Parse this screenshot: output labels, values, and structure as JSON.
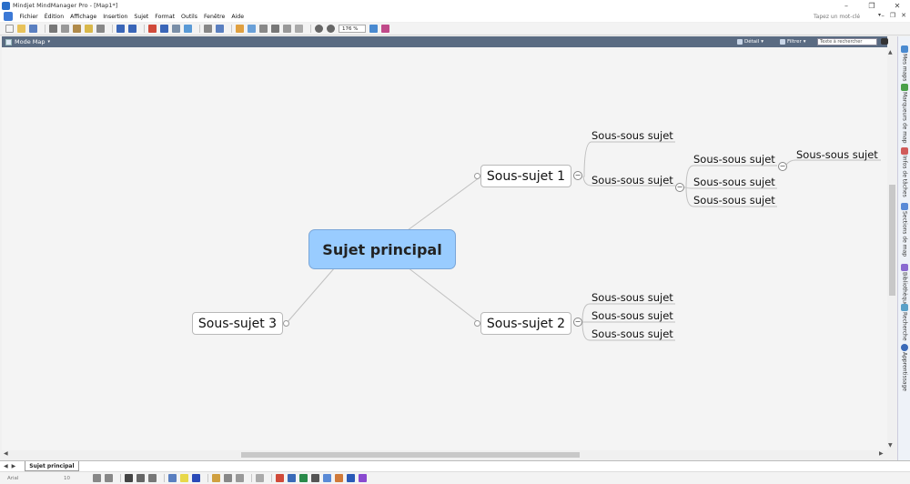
{
  "window": {
    "title": "Mindjet MindManager Pro - [Map1*]",
    "controls": [
      "–",
      "❐",
      "✕"
    ]
  },
  "menu": {
    "items": [
      "Fichier",
      "Édition",
      "Affichage",
      "Insertion",
      "Sujet",
      "Format",
      "Outils",
      "Fenêtre",
      "Aide"
    ],
    "help_placeholder": "Tapez un mot-clé",
    "doc_controls": [
      "–",
      "❐",
      "✕"
    ]
  },
  "toolbar": {
    "zoom_value": "176 %"
  },
  "panel": {
    "mode_label": "Mode Map",
    "detail_label": "Détail",
    "filter_label": "Filtrer",
    "search_placeholder": "Texte à rechercher"
  },
  "map": {
    "central_topic": "Sujet principal",
    "subtopic_1": {
      "label": "Sous-sujet 1",
      "children": [
        {
          "label": "Sous-sous sujet"
        },
        {
          "label": "Sous-sous sujet",
          "children": [
            {
              "label": "Sous-sous sujet",
              "children": [
                {
                  "label": "Sous-sous sujet"
                }
              ]
            },
            {
              "label": "Sous-sous sujet"
            },
            {
              "label": "Sous-sous sujet"
            }
          ]
        }
      ]
    },
    "subtopic_2": {
      "label": "Sous-sujet 2",
      "children": [
        {
          "label": "Sous-sous sujet"
        },
        {
          "label": "Sous-sous sujet"
        },
        {
          "label": "Sous-sous sujet"
        }
      ]
    },
    "subtopic_3": {
      "label": "Sous-sujet 3"
    },
    "collapse_symbol": "−"
  },
  "side_panel": {
    "tabs": [
      "Mes maps",
      "Marqueurs de map",
      "Infos de tâches",
      "Sections de map",
      "Bibliothèque",
      "Recherche",
      "Apprentissage"
    ]
  },
  "sheet_tabs": {
    "active": "Sujet principal"
  },
  "format_bar": {
    "font": "Arial",
    "size": "10"
  },
  "colors": {
    "central_fill": "#99ccff",
    "panel_header": "#5a6b82",
    "line": "#c0c0c0"
  }
}
